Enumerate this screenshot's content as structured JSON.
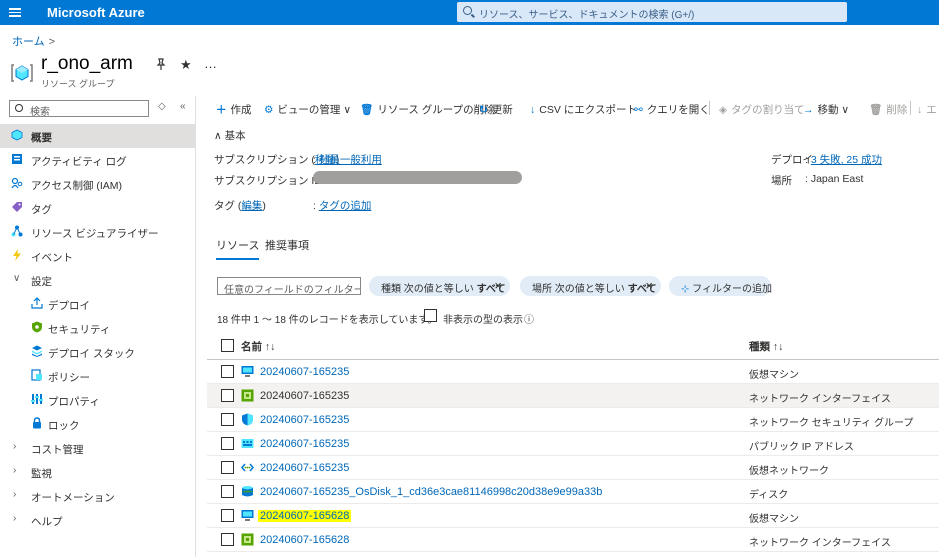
{
  "topbar": {
    "brand": "Microsoft Azure",
    "search_placeholder": "リソース、サービス、ドキュメントの検索 (G+/)"
  },
  "breadcrumb": {
    "home": "ホーム",
    "sep": ">"
  },
  "resource": {
    "name": "r_ono_arm",
    "type": "リソース グループ",
    "more": "…"
  },
  "sidebar": {
    "search_placeholder": "検索",
    "items": [
      {
        "label": "概要",
        "icon": "resource-group-icon",
        "active": true
      },
      {
        "label": "アクティビティ ログ",
        "icon": "activity-log-icon"
      },
      {
        "label": "アクセス制御 (IAM)",
        "icon": "iam-icon"
      },
      {
        "label": "タグ",
        "icon": "tag-icon"
      },
      {
        "label": "リソース ビジュアライザー",
        "icon": "visualizer-icon"
      },
      {
        "label": "イベント",
        "icon": "event-icon"
      },
      {
        "label": "設定",
        "expanded": true
      },
      {
        "label": "デプロイ",
        "icon": "deploy-icon",
        "sub": true
      },
      {
        "label": "セキュリティ",
        "icon": "security-icon",
        "sub": true
      },
      {
        "label": "デプロイ スタック",
        "icon": "deployment-stack-icon",
        "sub": true
      },
      {
        "label": "ポリシー",
        "icon": "policy-icon",
        "sub": true
      },
      {
        "label": "プロパティ",
        "icon": "properties-icon",
        "sub": true
      },
      {
        "label": "ロック",
        "icon": "lock-icon",
        "sub": true
      },
      {
        "label": "コスト管理",
        "collapsed": true
      },
      {
        "label": "監視",
        "collapsed": true
      },
      {
        "label": "オートメーション",
        "collapsed": true
      },
      {
        "label": "ヘルプ",
        "collapsed": true
      }
    ]
  },
  "toolbar": {
    "create": "作成",
    "view": "ビューの管理",
    "delete_rg": "リソース グループの削除",
    "refresh": "更新",
    "csv": "CSV にエクスポート",
    "query": "クエリを開く",
    "assign_tag": "タグの割り当て",
    "move": "移動",
    "delete": "削除",
    "export": "エ"
  },
  "essentials": {
    "header": "基本",
    "subscription_label": "サブスクリプション (",
    "move_link": "移動",
    "subscription_close": ")",
    "subscription_value": "社員一般利用",
    "subscription_id_label": "サブスクリプション ID",
    "tag_label": "タグ (",
    "edit_link": "編集",
    "tag_close": ")",
    "tag_value": "タグの追加",
    "deploy_label": "デプロイ",
    "deploy_value": "3 失敗, 25 成功",
    "location_label": "場所",
    "location_value": "Japan East",
    "colon": ":"
  },
  "tabs": {
    "resources": "リソース",
    "recommendations": "推奨事項"
  },
  "filters": {
    "placeholder": "任意のフィールドのフィルター...",
    "type_filter_prefix": "種類 次の値と等しい ",
    "type_filter_value": "すべて",
    "location_filter_prefix": "場所 次の値と等しい ",
    "location_filter_value": "すべて",
    "add_filter": "フィルターの追加"
  },
  "list": {
    "count_text": "18 件中 1 ～ 18 件のレコードを表示しています。",
    "hidden_types": "非表示の型の表示",
    "col_name": "名前 ↑↓",
    "col_type": "種類 ↑↓",
    "rows": [
      {
        "name": "20240607-165235",
        "type": "仮想マシン",
        "icon": "vm-icon"
      },
      {
        "name": "20240607-165235",
        "type": "ネットワーク インターフェイス",
        "icon": "nic-icon"
      },
      {
        "name": "20240607-165235",
        "type": "ネットワーク セキュリティ グループ",
        "icon": "nsg-icon"
      },
      {
        "name": "20240607-165235",
        "type": "パブリック IP アドレス",
        "icon": "public-ip-icon"
      },
      {
        "name": "20240607-165235",
        "type": "仮想ネットワーク",
        "icon": "vnet-icon"
      },
      {
        "name": "20240607-165235_OsDisk_1_cd36e3cae81146998c20d38e9e99a33b",
        "type": "ディスク",
        "icon": "disk-icon"
      },
      {
        "name": "20240607-165628",
        "type": "仮想マシン",
        "icon": "vm-icon"
      },
      {
        "name": "20240607-165628",
        "type": "ネットワーク インターフェイス",
        "icon": "nic-icon"
      }
    ]
  }
}
